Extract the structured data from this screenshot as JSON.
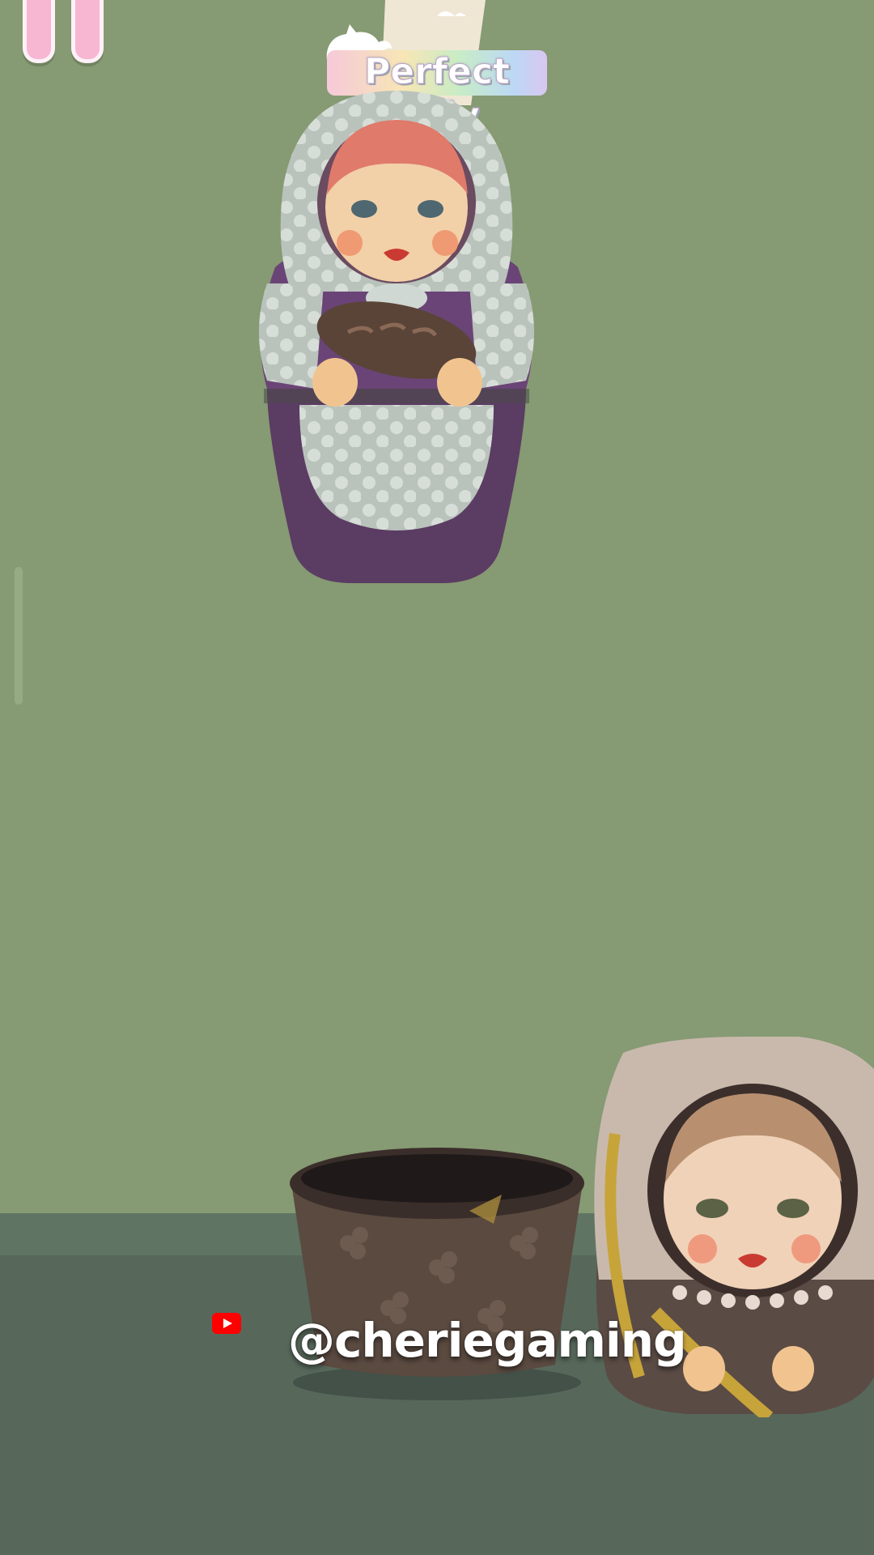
{
  "game": {
    "logo_text": "Perfect Tidy",
    "watermark_handle": "@cheriegaming"
  },
  "controls": {
    "pause_icon": "pause-icon",
    "youtube_icon": "youtube-icon"
  },
  "scene": {
    "items": [
      {
        "name": "matryoshka doll holding bread",
        "icon": "matryoshka-doll-bread"
      },
      {
        "name": "woven basket",
        "icon": "basket"
      },
      {
        "name": "matryoshka doll holding wheat",
        "icon": "matryoshka-doll-wheat"
      }
    ]
  },
  "colors": {
    "wall": "#869a73",
    "floor": "#57685b",
    "pause_pink": "#f7b6d2",
    "youtube_red": "#ff0000"
  }
}
